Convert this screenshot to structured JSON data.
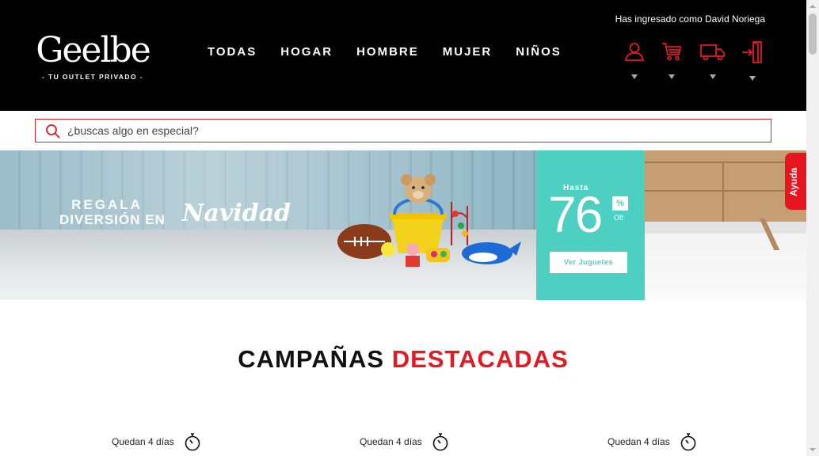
{
  "header": {
    "logged_in_text": "Has ingresado como David Noriega",
    "logo_text": "Geelbe",
    "logo_tagline": "- TU OUTLET PRIVADO -",
    "nav": [
      "TODAS",
      "HOGAR",
      "HOMBRE",
      "MUJER",
      "NIÑOS"
    ],
    "icons": [
      "user-icon",
      "cart-icon",
      "truck-icon",
      "logout-icon"
    ],
    "accent_color": "#e01b24"
  },
  "search": {
    "placeholder": "¿buscas algo en especial?"
  },
  "banner": {
    "line1": "REGALA",
    "line2": "DIVERSIÓN EN",
    "script": "Navidad",
    "promo_prefix": "Hasta",
    "promo_value": "76",
    "promo_percent": "%",
    "promo_off": "Off",
    "cta": "Ver Juguetes",
    "promo_color": "#4dcfc1"
  },
  "help_tab": "Ayuda",
  "section": {
    "title_part1": "CAMPAÑAS",
    "title_part2": "DESTACADAS"
  },
  "campaigns": [
    {
      "remaining": "Quedan 4 días"
    },
    {
      "remaining": "Quedan 4 días"
    },
    {
      "remaining": "Quedan 4 días"
    }
  ]
}
